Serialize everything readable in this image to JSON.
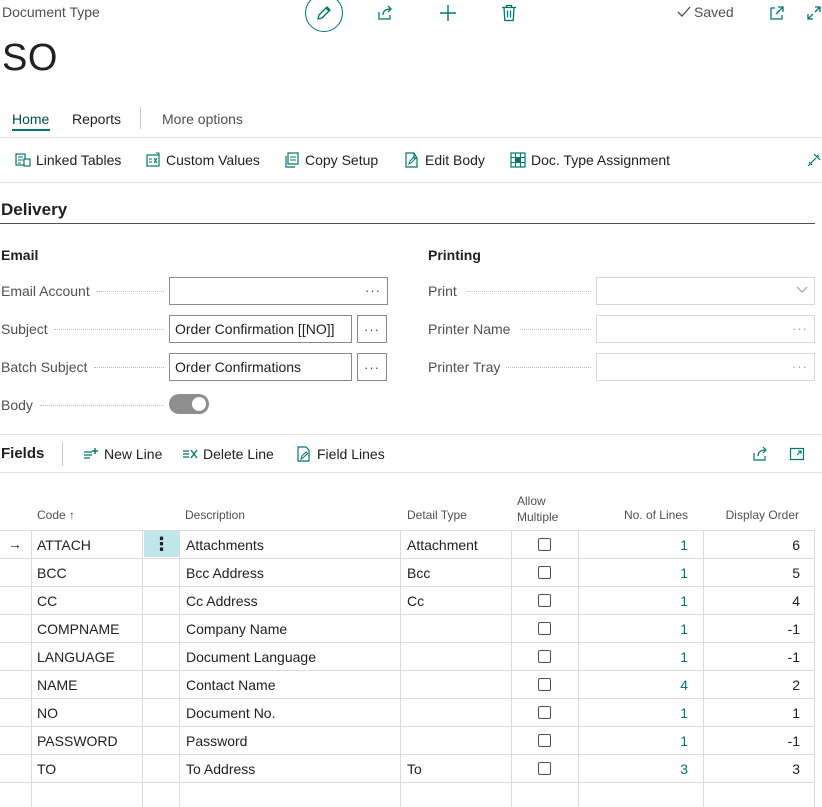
{
  "header": {
    "caption": "Document Type",
    "title": "SO",
    "saved_label": "Saved",
    "icons": [
      "edit-icon",
      "share-icon",
      "add-icon",
      "delete-icon",
      "open-new-window-icon",
      "expand-icon"
    ]
  },
  "tabs": [
    {
      "label": "Home",
      "active": true
    },
    {
      "label": "Reports",
      "active": false
    },
    {
      "label": "More options",
      "active": false
    }
  ],
  "actions": [
    {
      "label": "Linked Tables",
      "icon": "linked-tables-icon"
    },
    {
      "label": "Custom Values",
      "icon": "custom-values-icon"
    },
    {
      "label": "Copy Setup",
      "icon": "copy-icon"
    },
    {
      "label": "Edit Body",
      "icon": "edit-body-icon"
    },
    {
      "label": "Doc. Type Assignment",
      "icon": "assignment-icon"
    }
  ],
  "section": {
    "title": "Delivery",
    "email": {
      "group_title": "Email",
      "email_account": {
        "label": "Email Account",
        "value": ""
      },
      "subject": {
        "label": "Subject",
        "value": "Order Confirmation [[NO]]"
      },
      "batch_subject": {
        "label": "Batch Subject",
        "value": "Order Confirmations"
      },
      "body": {
        "label": "Body",
        "enabled": false
      },
      "ellipsis": "···"
    },
    "printing": {
      "group_title": "Printing",
      "print": {
        "label": "Print",
        "value": ""
      },
      "printer_name": {
        "label": "Printer Name",
        "value": ""
      },
      "printer_tray": {
        "label": "Printer Tray",
        "value": ""
      }
    }
  },
  "fields": {
    "title": "Fields",
    "actions": [
      {
        "label": "New Line",
        "icon": "new-line-icon"
      },
      {
        "label": "Delete Line",
        "icon": "delete-line-icon"
      },
      {
        "label": "Field Lines",
        "icon": "field-lines-icon"
      }
    ],
    "columns": {
      "code": "Code ↑",
      "description": "Description",
      "detail_type": "Detail Type",
      "allow_multiple_1": "Allow",
      "allow_multiple_2": "Multiple",
      "no_of_lines": "No. of Lines",
      "display_order": "Display Order"
    },
    "row_arrow": "→",
    "row_menu": "⋮",
    "rows": [
      {
        "code": "ATTACH",
        "description": "Attachments",
        "detail_type": "Attachment",
        "allow_multiple": false,
        "no_of_lines": "1",
        "display_order": "6"
      },
      {
        "code": "BCC",
        "description": "Bcc Address",
        "detail_type": "Bcc",
        "allow_multiple": false,
        "no_of_lines": "1",
        "display_order": "5"
      },
      {
        "code": "CC",
        "description": "Cc Address",
        "detail_type": "Cc",
        "allow_multiple": false,
        "no_of_lines": "1",
        "display_order": "4"
      },
      {
        "code": "COMPNAME",
        "description": "Company Name",
        "detail_type": "",
        "allow_multiple": false,
        "no_of_lines": "1",
        "display_order": "-1"
      },
      {
        "code": "LANGUAGE",
        "description": "Document Language",
        "detail_type": "",
        "allow_multiple": false,
        "no_of_lines": "1",
        "display_order": "-1"
      },
      {
        "code": "NAME",
        "description": "Contact Name",
        "detail_type": "",
        "allow_multiple": false,
        "no_of_lines": "4",
        "display_order": "2"
      },
      {
        "code": "NO",
        "description": "Document No.",
        "detail_type": "",
        "allow_multiple": false,
        "no_of_lines": "1",
        "display_order": "1"
      },
      {
        "code": "PASSWORD",
        "description": "Password",
        "detail_type": "",
        "allow_multiple": false,
        "no_of_lines": "1",
        "display_order": "-1"
      },
      {
        "code": "TO",
        "description": "To Address",
        "detail_type": "To",
        "allow_multiple": false,
        "no_of_lines": "3",
        "display_order": "3"
      }
    ]
  },
  "colors": {
    "accent": "#00786f",
    "row_highlight": "#bfe7ea",
    "toggle_off": "#8e8e8e"
  }
}
